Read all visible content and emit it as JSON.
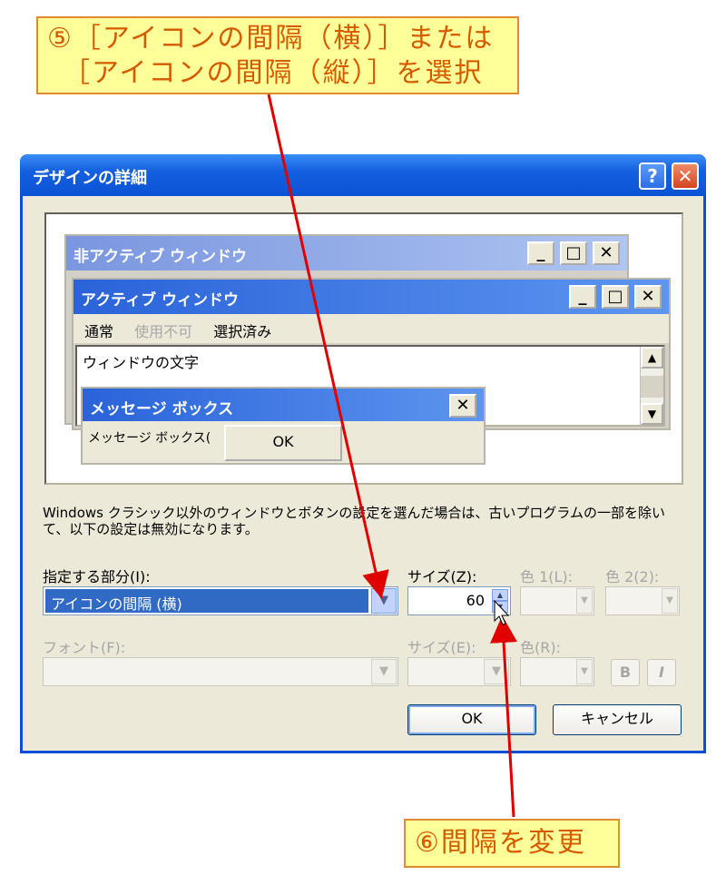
{
  "callouts": {
    "step5": "⑤［アイコンの間隔（横）］または\n　［アイコンの間隔（縦）］を選択",
    "step6": "⑥間隔を変更"
  },
  "dialog": {
    "title": "デザインの詳細",
    "help_label": "?",
    "close_label": "✕"
  },
  "preview": {
    "inactive_title": "非アクティブ ウィンドウ",
    "active_title": "アクティブ ウィンドウ",
    "menu": [
      "通常",
      "使用不可",
      "選択済み"
    ],
    "window_text": "ウィンドウの文字",
    "msgbox_title": "メッセージ ボックス",
    "msgbox_text": "メッセージ ボックス(",
    "msgbox_ok": "OK"
  },
  "description": "Windows クラシック以外のウィンドウとボタンの設定を選んだ場合は、古いプログラムの一部を除いて、以下の設定は無効になります。",
  "form": {
    "item_label": "指定する部分(I):",
    "item_value": "アイコンの間隔 (横)",
    "size_label": "サイズ(Z):",
    "size_value": "60",
    "color1_label": "色 1(L):",
    "color2_label": "色 2(2):",
    "font_label": "フォント(F):",
    "font_size_label": "サイズ(E):",
    "font_color_label": "色(R):",
    "bold_label": "B",
    "italic_label": "I"
  },
  "buttons": {
    "ok": "OK",
    "cancel": "キャンセル"
  },
  "colors": {
    "titlebar": "#0a52d4",
    "callout_fill": "#ffff99",
    "callout_text": "#d65a00",
    "arrow": "#e00000",
    "selection": "#316ac5"
  }
}
